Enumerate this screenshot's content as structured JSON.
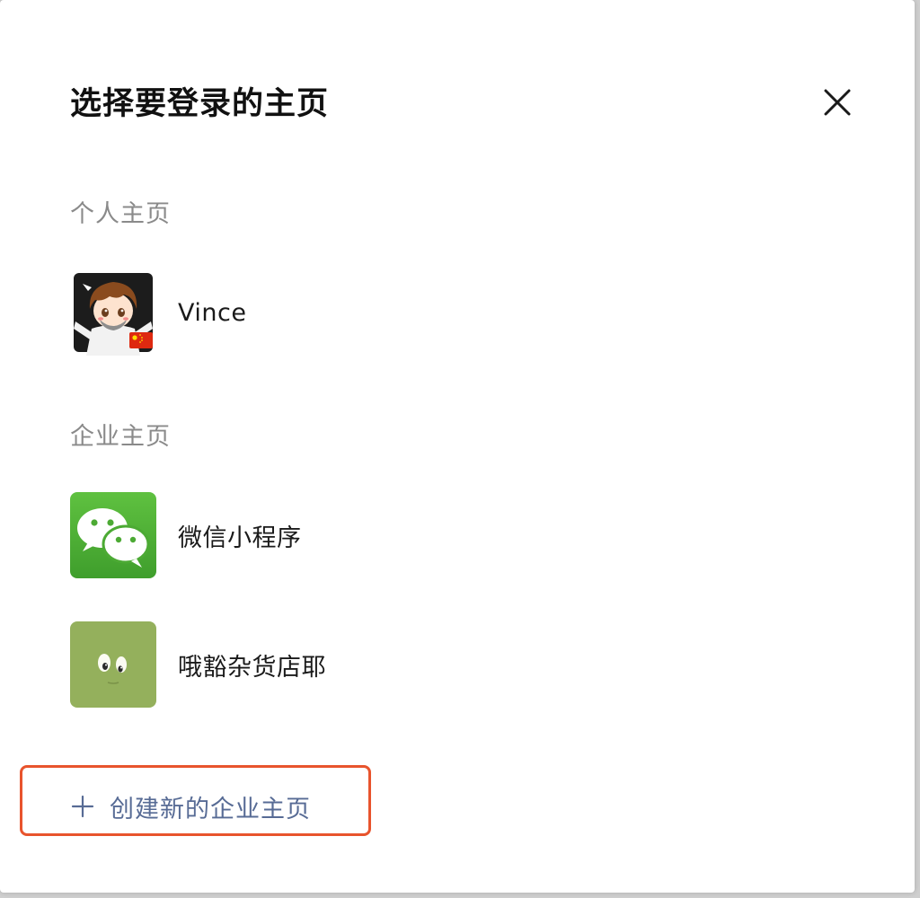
{
  "dialog": {
    "title": "选择要登录的主页",
    "close_icon": "close-icon"
  },
  "personal": {
    "section_label": "个人主页",
    "accounts": [
      {
        "name": "Vince",
        "avatar": "anime-boy-avatar",
        "badge": "china-flag-icon"
      }
    ]
  },
  "business": {
    "section_label": "企业主页",
    "accounts": [
      {
        "name": "微信小程序",
        "avatar": "wechat-logo-avatar"
      },
      {
        "name": "哦豁杂货店耶",
        "avatar": "cartoon-eyes-avatar"
      }
    ]
  },
  "create": {
    "icon": "plus-icon",
    "label": "创建新的企业主页"
  },
  "colors": {
    "link": "#576b95",
    "highlight_border": "#e8542d",
    "section_label": "#8a8a8a",
    "wechat_green": "#4fb83a",
    "olive_avatar": "#94b05c"
  }
}
